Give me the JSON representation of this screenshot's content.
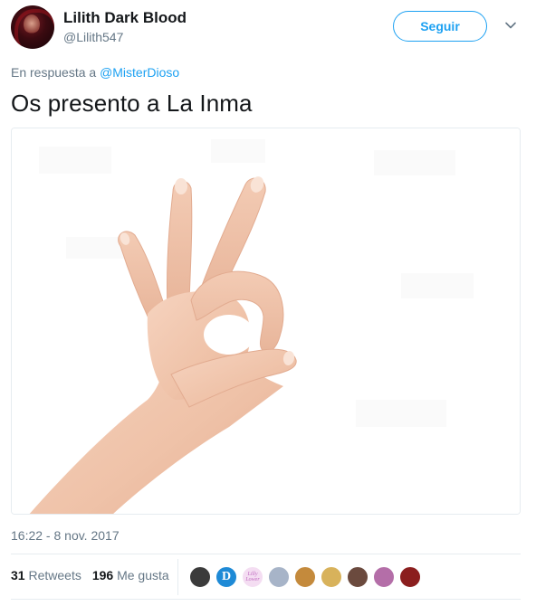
{
  "user": {
    "name": "Lilith Dark Blood",
    "handle": "@Lilith547"
  },
  "follow_button": "Seguir",
  "reply": {
    "prefix": "En respuesta a ",
    "to": "@MisterDioso"
  },
  "tweet": {
    "text": "Os presento a La Inma",
    "timestamp": "16:22 - 8 nov. 2017"
  },
  "stats": {
    "retweets_count": "31",
    "retweets_label": "Retweets",
    "likes_count": "196",
    "likes_label": "Me gusta"
  },
  "likers": [
    {
      "initial": "",
      "color": "#3b3b3b"
    },
    {
      "initial": "D",
      "color": "#1e8ad6"
    },
    {
      "initial": "Lilly Lower",
      "color": "#f4ddf2"
    },
    {
      "initial": "",
      "color": "#a7b4c8"
    },
    {
      "initial": "",
      "color": "#c48a3c"
    },
    {
      "initial": "",
      "color": "#d8b25b"
    },
    {
      "initial": "",
      "color": "#6b4a3e"
    },
    {
      "initial": "",
      "color": "#b46ea8"
    },
    {
      "initial": "",
      "color": "#8b1e1e"
    }
  ],
  "colors": {
    "accent": "#1da1f2",
    "secondary_text": "#657786",
    "primary_text": "#14171a"
  }
}
